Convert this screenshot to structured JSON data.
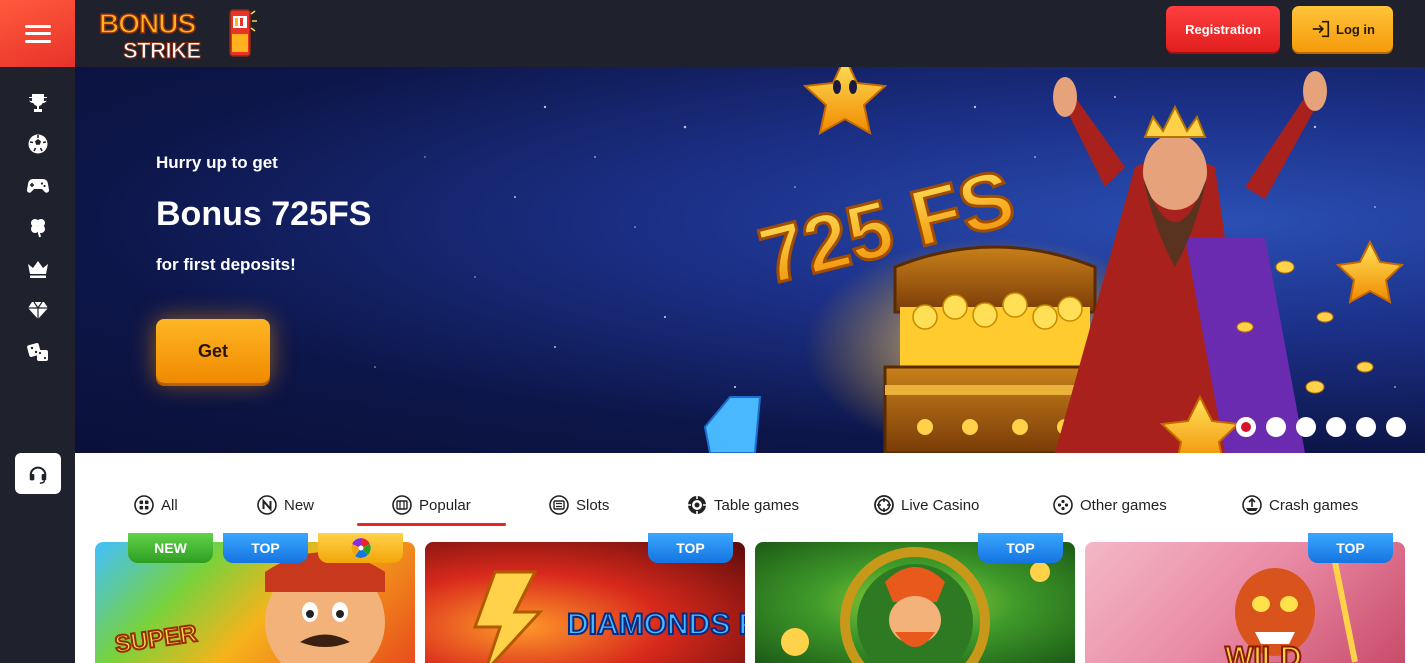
{
  "brand": {
    "line1": "BONUS",
    "line2": "STRIKE"
  },
  "header": {
    "registration_label": "Registration",
    "login_label": "Log in"
  },
  "sidebar": {
    "icons": [
      "trophy-icon",
      "soccer-ball-icon",
      "gamepad-icon",
      "clover-icon",
      "crown-icon",
      "diamond-icon",
      "dice-icon",
      "headset-icon"
    ]
  },
  "banner": {
    "subtitle": "Hurry up to get",
    "title": "Bonus 725FS",
    "note": "for first deposits!",
    "cta_label": "Get",
    "art_text": "725 FS",
    "slides_total": 6,
    "active_slide": 1
  },
  "tabs": [
    {
      "label": "All",
      "icon": "grid-icon"
    },
    {
      "label": "New",
      "icon": "new-circle-icon"
    },
    {
      "label": "Popular",
      "icon": "popular-icon",
      "active": true
    },
    {
      "label": "Slots",
      "icon": "slot-icon"
    },
    {
      "label": "Table games",
      "icon": "table-games-icon"
    },
    {
      "label": "Live Casino",
      "icon": "live-casino-icon"
    },
    {
      "label": "Other games",
      "icon": "other-games-icon"
    },
    {
      "label": "Crash games",
      "icon": "crash-games-icon"
    }
  ],
  "games": [
    {
      "title": "SUPER",
      "badges": [
        "NEW",
        "TOP"
      ]
    },
    {
      "title": "DIAMONDS POWER",
      "badges": [
        "TOP"
      ]
    },
    {
      "title": "",
      "badges": [
        "TOP"
      ]
    },
    {
      "title": "WILD",
      "badges": [
        "TOP"
      ]
    }
  ],
  "colors": {
    "accent_red": "#e8262a",
    "accent_orange": "#f59a0b",
    "sidebar_bg": "#1f222c",
    "badge_top": "#1574e0",
    "badge_new": "#2d9e22"
  }
}
